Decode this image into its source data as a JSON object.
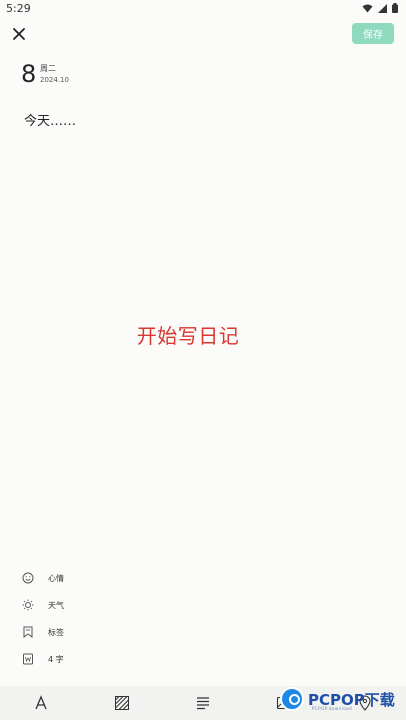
{
  "status": {
    "time": "5:29"
  },
  "header": {
    "save_label": "保存"
  },
  "date": {
    "day": "8",
    "weekday": "周二",
    "year_month": "2024.10"
  },
  "editor": {
    "text": "今天……"
  },
  "overlay": {
    "caption": "开始写日记"
  },
  "meta": {
    "mood": "心情",
    "weather": "天气",
    "tag": "标签",
    "word_count": "4 字"
  },
  "colors": {
    "accent": "#8fd9bf",
    "caption": "#d9372f"
  },
  "logo": {
    "text_main": "PCPOP",
    "text_suffix": "下载",
    "tagline": "PCPOP.download"
  }
}
